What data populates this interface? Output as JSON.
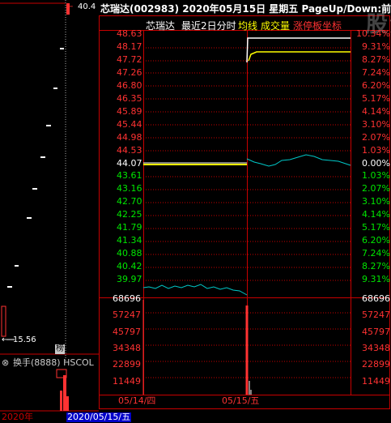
{
  "header": {
    "title": "芯瑞达(002983)",
    "date": "2020年05月15日",
    "weekday": "星期五",
    "nav_hint": "PageUp/Down:前后日"
  },
  "subheader": {
    "name": "芯瑞达",
    "period": "最近2日分时",
    "avg_line": "均线",
    "volume": "成交量",
    "limit": "涨停板坐标"
  },
  "watermark": "股海明灯",
  "price_axis": {
    "left": [
      "48.63",
      "48.17",
      "47.72",
      "47.26",
      "46.80",
      "46.35",
      "45.89",
      "45.44",
      "44.98",
      "44.53",
      "44.07",
      "43.61",
      "43.16",
      "42.70",
      "42.25",
      "41.79",
      "41.34",
      "40.88",
      "40.42",
      "39.97"
    ],
    "right": [
      "10.34%",
      "9.31%",
      "8.27%",
      "7.24%",
      "6.20%",
      "5.17%",
      "4.14%",
      "3.10%",
      "2.07%",
      "1.03%",
      "0.00%",
      "1.03%",
      "2.07%",
      "3.10%",
      "4.14%",
      "5.17%",
      "6.20%",
      "7.24%",
      "8.27%",
      "9.31%"
    ]
  },
  "volume_axis": {
    "left": [
      "68696",
      "57247",
      "45797",
      "34348",
      "22899",
      "11449"
    ],
    "right": [
      "68696",
      "57247",
      "45797",
      "34348",
      "22899",
      "11449"
    ]
  },
  "date_labels": [
    "05/14/四",
    "05/15/五"
  ],
  "left_panel": {
    "top_price": "40.4",
    "low_price": "15.56",
    "indicator": "换手(8888) HSCOL",
    "bang_tag": "榜",
    "year": "2020年",
    "date": "2020/05/15/五"
  },
  "colors": {
    "up": "#ff3232",
    "down": "#00e600",
    "border": "#c80000",
    "avg_line": "#ffff00",
    "price_line": "#ffffff",
    "cyan_line": "#00c8c8"
  }
}
